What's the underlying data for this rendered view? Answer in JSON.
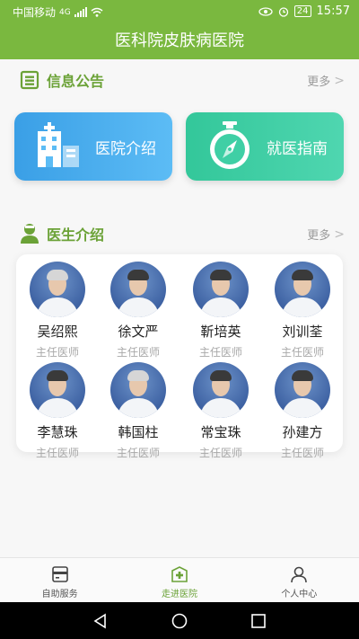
{
  "status_bar": {
    "carrier": "中国移动",
    "network": "4G",
    "battery": "24",
    "time": "15:57"
  },
  "app_title": "医科院皮肤病医院",
  "notice_section": {
    "title": "信息公告",
    "more": "更多",
    "icon": "notice-board-icon"
  },
  "cards": [
    {
      "label": "医院介绍",
      "icon": "hospital-building-icon"
    },
    {
      "label": "就医指南",
      "icon": "stopwatch-compass-icon"
    }
  ],
  "doctor_section": {
    "title": "医生介绍",
    "more": "更多",
    "icon": "doctor-person-icon"
  },
  "doctors": [
    {
      "name": "吴绍熙",
      "title": "主任医师"
    },
    {
      "name": "徐文严",
      "title": "主任医师"
    },
    {
      "name": "靳培英",
      "title": "主任医师"
    },
    {
      "name": "刘训荃",
      "title": "主任医师"
    },
    {
      "name": "李慧珠",
      "title": "主任医师"
    },
    {
      "name": "韩国柱",
      "title": "主任医师"
    },
    {
      "name": "常宝珠",
      "title": "主任医师"
    },
    {
      "name": "孙建方",
      "title": "主任医师"
    }
  ],
  "bottom_nav": [
    {
      "label": "自助服务",
      "icon": "self-service-icon"
    },
    {
      "label": "走进医院",
      "icon": "hospital-cross-icon",
      "active": true
    },
    {
      "label": "个人中心",
      "icon": "user-icon"
    }
  ],
  "colors": {
    "brand_green": "#7ab83f",
    "hospital_card_blue": "#3a9fe6",
    "guide_card_teal": "#33c79a"
  }
}
